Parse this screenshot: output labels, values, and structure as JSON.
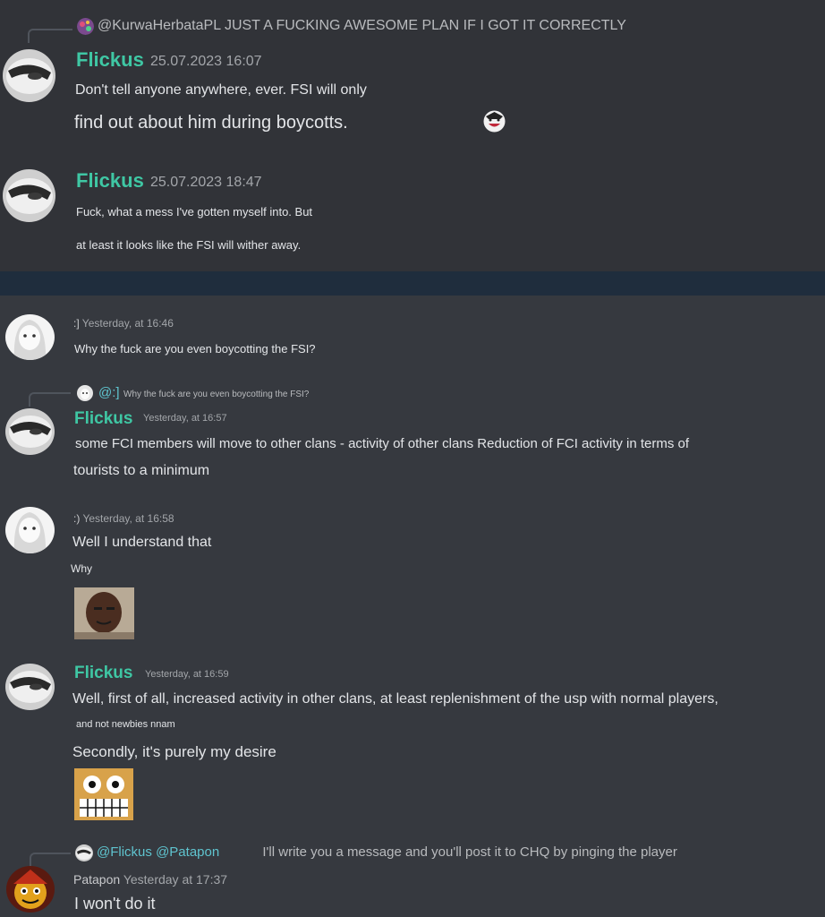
{
  "messages": {
    "m1": {
      "reply": {
        "mention": "@KurwaHerbataPL",
        "text": "JUST A FUCKING AWESOME PLAN IF I GOT IT CORRECTLY"
      },
      "author": "Flickus",
      "timestamp": "25.07.2023 16:07",
      "line1": "Don't tell anyone anywhere, ever. FSI will only",
      "line2": "find out about him during boycotts."
    },
    "m2": {
      "author": "Flickus",
      "timestamp": "25.07.2023 18:47",
      "line1": "Fuck, what a mess I've gotten myself into. But",
      "line2": "at least it looks like the FSI will wither away."
    },
    "m3": {
      "author": ":]",
      "timestamp": "Yesterday, at 16:46",
      "line1": "Why the fuck are you even boycotting the FSI?"
    },
    "m4": {
      "reply": {
        "mention": "@:]",
        "text": "Why the fuck are you even boycotting the FSI?"
      },
      "author": "Flickus",
      "timestamp": "Yesterday, at 16:57",
      "line1": "some FCI members will move to other clans - activity of other clans Reduction of FCI activity in terms of",
      "line2": "tourists to a minimum"
    },
    "m5": {
      "author": ":)",
      "timestamp": "Yesterday, at 16:58",
      "line1": "Well I understand that",
      "line2": "Why"
    },
    "m6": {
      "author": "Flickus",
      "timestamp": "Yesterday, at 16:59",
      "line1": "Well, first of all, increased activity in other clans, at least replenishment of the usp with normal players,",
      "line2": "and not newbies nnam",
      "line3": "Secondly, it's purely my desire"
    },
    "m7": {
      "reply": {
        "mention1": "@Flickus",
        "mention2": "@Patapon",
        "text": "I'll write you a message and you'll post it to CHQ by pinging the player"
      },
      "author": "Patapon",
      "timestamp": "Yesterday at 17:37",
      "line1": "I won't do it"
    }
  },
  "icons": {
    "m1_reply_avatar": "reply-avatar-icon",
    "m1_emoji": "joker-emoji-icon",
    "m5_image": "portrait-image",
    "m6_emoji": "sticker-image"
  },
  "colors": {
    "background": "#36393f",
    "top_background": "#313338",
    "band": "#1f2d3d",
    "username": "#3fc7a4",
    "timestamp": "#a3a6aa"
  }
}
